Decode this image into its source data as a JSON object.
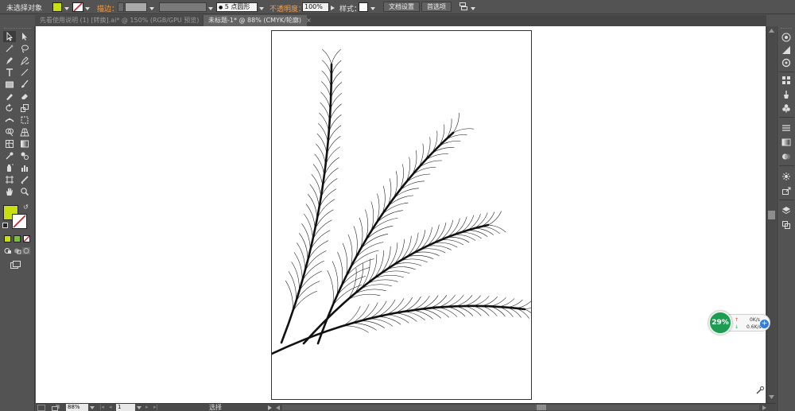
{
  "control_bar": {
    "selection_status": "未选择对象",
    "stroke_label": "描边：",
    "brush_value": "5 点圆形",
    "opacity_label": "不透明度：",
    "opacity_value": "100%",
    "style_label": "样式：",
    "doc_setup_button": "文档设置",
    "preferences_button": "首选项",
    "fill_color": "#c8e00d"
  },
  "tabs": [
    {
      "label": "先看使用说明 (1) [转换].ai* @ 150% (RGB/GPU 预览)",
      "close": "×",
      "active": false
    },
    {
      "label": "未标题-1* @ 88% (CMYK/轮廓)",
      "close": "×",
      "active": true
    }
  ],
  "status_bar": {
    "zoom_value": "88%",
    "artboard_number": "1",
    "tool_status": "选择"
  },
  "network_widget": {
    "percent": "29%",
    "upload_speed": "0K/s",
    "download_speed": "0.6K/s",
    "up_arrow": "↑",
    "down_arrow": "↓",
    "plus": "+"
  },
  "colors": {
    "fill": "#c8e00d",
    "badge_green": "#1e9c53",
    "accent_orange": "#ff9f3e"
  }
}
